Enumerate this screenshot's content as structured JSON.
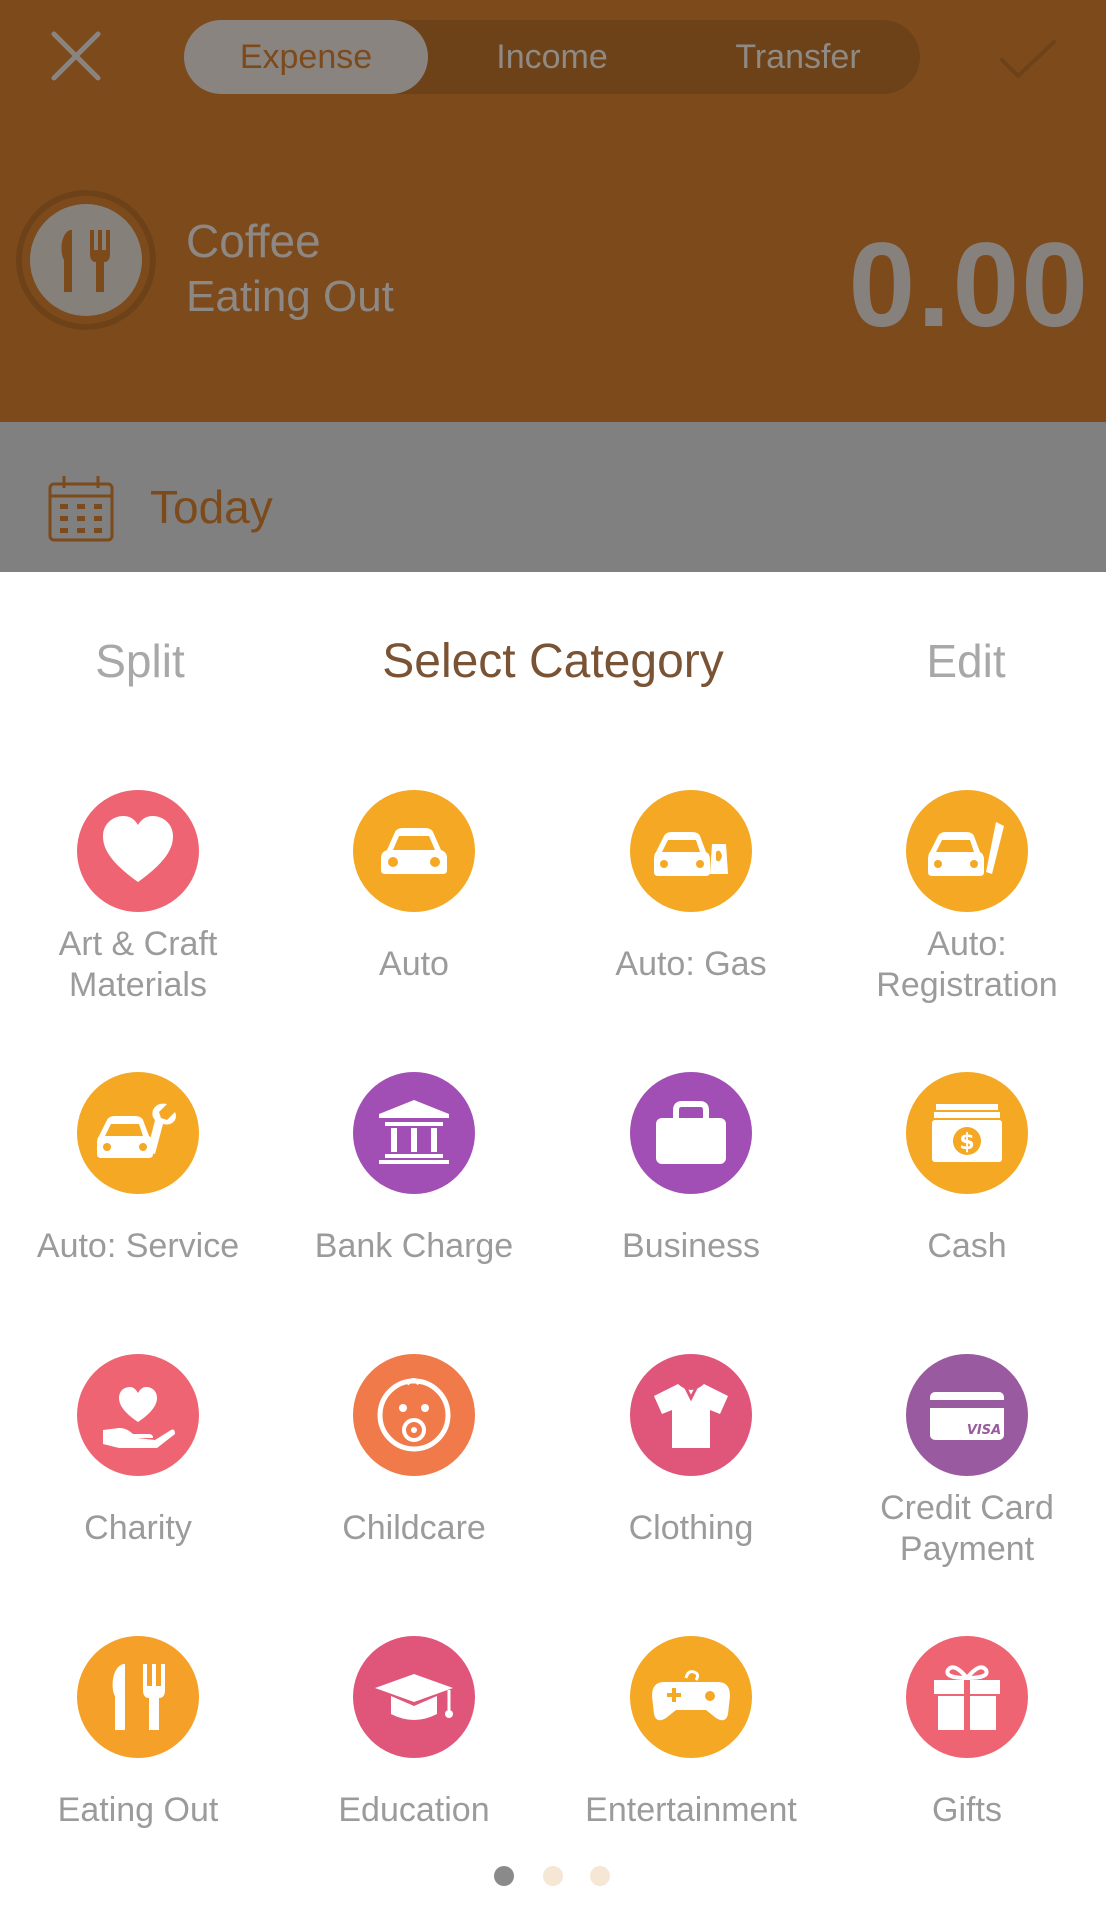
{
  "colors": {
    "header_bg": "#7d4a1c",
    "dim_row": "#808080",
    "title": "#7a5335",
    "label": "#9b9b9b"
  },
  "header": {
    "tabs": [
      {
        "label": "Expense",
        "active": true
      },
      {
        "label": "Income",
        "active": false
      },
      {
        "label": "Transfer",
        "active": false
      }
    ],
    "close_icon": "close-icon",
    "confirm_icon": "checkmark-icon",
    "current": {
      "icon": "fork-knife-icon",
      "title": "Coffee",
      "subtitle": "Eating Out",
      "amount": "0.00"
    },
    "date": {
      "icon": "calendar-icon",
      "label": "Today"
    }
  },
  "sheet": {
    "split_label": "Split",
    "title": "Select Category",
    "edit_label": "Edit"
  },
  "categories": [
    {
      "label": "Art & Craft\nMaterials",
      "icon": "heart-icon",
      "color": "#ee6472"
    },
    {
      "label": "Auto",
      "icon": "car-icon",
      "color": "#f5a823"
    },
    {
      "label": "Auto: Gas",
      "icon": "car-gas-icon",
      "color": "#f5a823"
    },
    {
      "label": "Auto:\nRegistration",
      "icon": "car-registration-icon",
      "color": "#f5a823"
    },
    {
      "label": "Auto: Service",
      "icon": "car-wrench-icon",
      "color": "#f5a823"
    },
    {
      "label": "Bank Charge",
      "icon": "bank-icon",
      "color": "#a24fb5"
    },
    {
      "label": "Business",
      "icon": "briefcase-icon",
      "color": "#a24fb5"
    },
    {
      "label": "Cash",
      "icon": "cash-icon",
      "color": "#f5a823"
    },
    {
      "label": "Charity",
      "icon": "hand-heart-icon",
      "color": "#ee6472"
    },
    {
      "label": "Childcare",
      "icon": "baby-icon",
      "color": "#f07a4a"
    },
    {
      "label": "Clothing",
      "icon": "tshirt-icon",
      "color": "#e0567a"
    },
    {
      "label": "Credit Card\nPayment",
      "icon": "credit-card-icon",
      "color": "#9a5aa0"
    },
    {
      "label": "Eating Out",
      "icon": "fork-knife-icon",
      "color": "#f5a028"
    },
    {
      "label": "Education",
      "icon": "graduation-cap-icon",
      "color": "#e0567a"
    },
    {
      "label": "Entertainment",
      "icon": "gamepad-icon",
      "color": "#f5a823"
    },
    {
      "label": "Gifts",
      "icon": "gift-icon",
      "color": "#ee6472"
    }
  ],
  "pager": {
    "pages": 3,
    "current": 1
  }
}
